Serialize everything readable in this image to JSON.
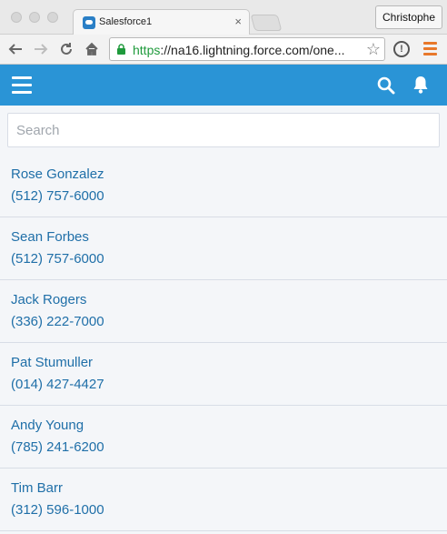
{
  "browser": {
    "tab_title": "Salesforce1",
    "tab_close": "×",
    "profile_name": "Christophe",
    "url_scheme": "https",
    "url_rest": "://na16.lightning.force.com/one...",
    "icons": [
      "back-icon",
      "forward-icon",
      "reload-icon",
      "home-icon",
      "lock-icon",
      "star-icon",
      "info-icon",
      "menu-icon"
    ]
  },
  "app": {
    "accent_color": "#2a94d6",
    "icons": [
      "hamburger-icon",
      "search-icon",
      "notifications-bell-icon"
    ]
  },
  "search": {
    "placeholder": "Search",
    "value": ""
  },
  "contacts": [
    {
      "name": "Rose Gonzalez",
      "phone": "(512) 757-6000"
    },
    {
      "name": "Sean Forbes",
      "phone": "(512) 757-6000"
    },
    {
      "name": "Jack Rogers",
      "phone": "(336) 222-7000"
    },
    {
      "name": "Pat Stumuller",
      "phone": "(014) 427-4427"
    },
    {
      "name": "Andy Young",
      "phone": "(785) 241-6200"
    },
    {
      "name": "Tim Barr",
      "phone": "(312) 596-1000"
    }
  ]
}
